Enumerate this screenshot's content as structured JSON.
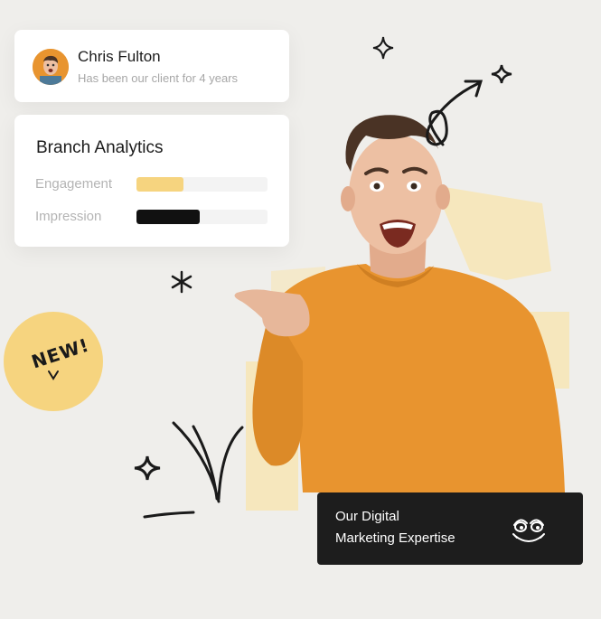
{
  "client": {
    "name": "Chris Fulton",
    "subtitle": "Has been our client for 4 years"
  },
  "analytics": {
    "title": "Branch Analytics",
    "metrics": [
      {
        "label": "Engagement",
        "value": 0.36,
        "color": "#f6d47f"
      },
      {
        "label": "Impression",
        "value": 0.48,
        "color": "#111111"
      }
    ]
  },
  "badge": {
    "text": "NEW!"
  },
  "promo": {
    "line1": "Our Digital",
    "line2": "Marketing Expertise",
    "icon": "smiling-face-icon"
  },
  "colors": {
    "accent": "#f6d47f",
    "sweater": "#e8942f",
    "dark": "#1d1d1d"
  }
}
